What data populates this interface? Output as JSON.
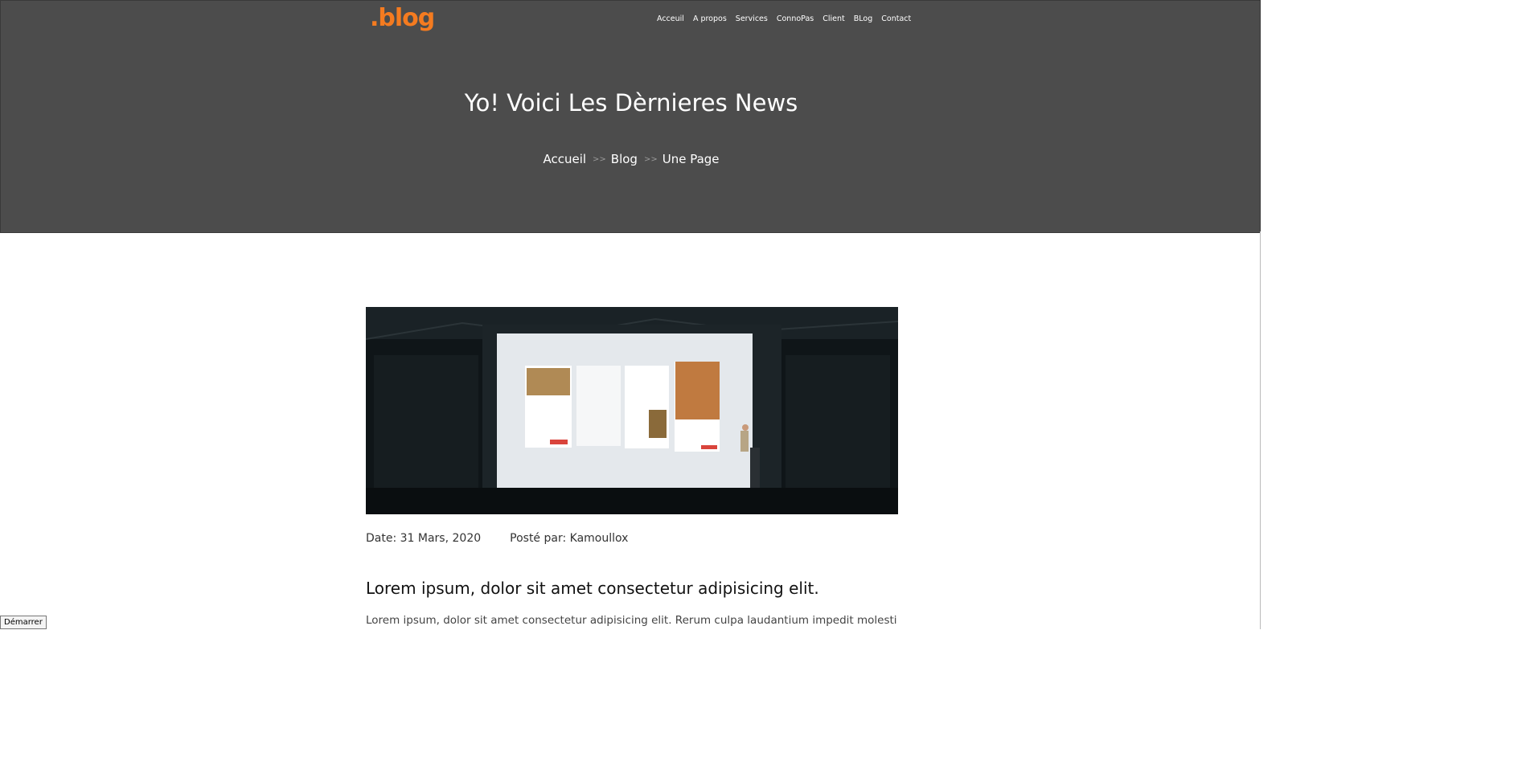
{
  "brand": {
    "logo_text": ".blog",
    "colors": {
      "logo": "#f47b20",
      "logo_bubble": "#7ec8b4",
      "hero_bg": "#4c4c4c"
    }
  },
  "nav": {
    "items": [
      {
        "label": "Acceuil"
      },
      {
        "label": "A propos"
      },
      {
        "label": "Services"
      },
      {
        "label": "ConnoPas"
      },
      {
        "label": "Client"
      },
      {
        "label": "BLog"
      },
      {
        "label": "Contact"
      }
    ]
  },
  "hero": {
    "title": "Yo! Voici Les Dèrnieres News",
    "breadcrumb": [
      "Accueil",
      "Blog",
      "Une Page"
    ]
  },
  "post": {
    "image_icon": "conference-photo",
    "date": "Date: 31 Mars, 2020",
    "author": "Posté par: Kamoullox",
    "title": "Lorem ipsum, dolor sit amet consectetur adipisicing elit.",
    "body": "Lorem ipsum, dolor sit amet consectetur adipisicing elit. Rerum culpa laudantium impedit molestias"
  },
  "footer": {
    "start_button": "Démarrer"
  }
}
